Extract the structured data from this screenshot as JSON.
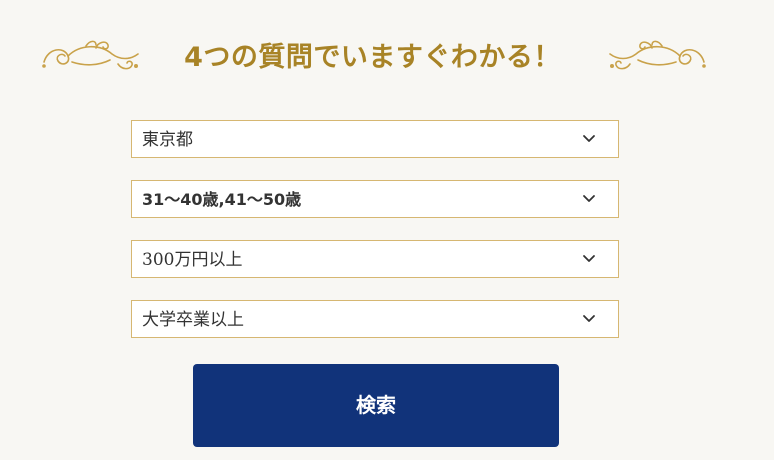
{
  "header": {
    "title": "4つの質問でいますぐわかる！"
  },
  "form": {
    "selects": [
      {
        "value": "東京都"
      },
      {
        "value": "31〜40歳,41〜50歳"
      },
      {
        "value": "300万円以上"
      },
      {
        "value": "大学卒業以上"
      }
    ],
    "search_label": "検索"
  },
  "icons": {
    "ornament": "flourish-ornament-icon",
    "chevron": "chevron-down-icon"
  },
  "colors": {
    "background": "#f8f7f3",
    "title_gold": "#a88326",
    "select_border": "#d6b772",
    "button_navy": "#11337a",
    "button_text": "#ffffff"
  }
}
